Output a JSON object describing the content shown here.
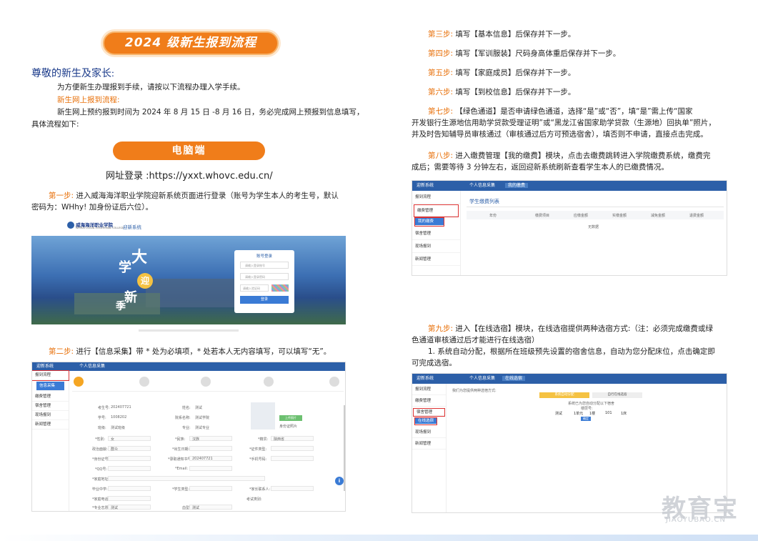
{
  "title": "2024 级新生报到流程",
  "greeting": "尊敬的新生及家长:",
  "intro": "为方便新生办理报到手续，请按以下流程办理入学手续。",
  "online_heading": "新生网上报到流程:",
  "online_text_1": "新生网上预约报到时间为 2024 年 8 月 15 日 -8 月 16 日，务必完成网上预报到信息填写，",
  "online_text_2": "具体流程如下:",
  "pc_label": "电脑端",
  "url_line": "网址登录 :https://yxxt.whovc.edu.cn/",
  "steps": {
    "s1_label": "第一步:",
    "s1_text_1": "进入威海海洋职业学院迎新系统页面进行登录（账号为学生本人的考生号，默认",
    "s1_text_2": "密码为：WHhy! 加身份证后六位）。",
    "s2_label": "第二步:",
    "s2_text": "进行【信息采集】带 * 处为必填项，* 处若本人无内容填写，可以填写“无”。",
    "s3_label": "第三步:",
    "s3_text": "填写【基本信息】后保存并下一步。",
    "s4_label": "第四步:",
    "s4_text": "填写【军训服装】尺码身高体重后保存并下一步。",
    "s5_label": "第五步:",
    "s5_text": "填写【家庭成员】后保存并下一步。",
    "s6_label": "第六步:",
    "s6_text": "填写【到校信息】后保存并下一步。",
    "s7_label": "第七步:",
    "s7_text_1": "【绿色通道】是否申请绿色通道，选择“是”或“否”，填“是”需上传“国家",
    "s7_text_2": "开发银行生源地信用助学贷款受理证明”或“黑龙江省国家助学贷款（生源地）回执单”照片，",
    "s7_text_3": "并及时告知辅导员审核通过（审核通过后方可预选宿舍），填否则不申请，直接点击完成。",
    "s8_label": "第八步:",
    "s8_text_1": "进入缴费管理【我的缴费】模块，点击去缴费跳转进入学院缴费系统，缴费完",
    "s8_text_2": "成后；需要等待 3 分钟左右，返回迎新系统刷新查看学生本人的已缴费情况。",
    "s9_label": "第九步:",
    "s9_text_1": "进入【在线选宿】模块，在线选宿提供两种选宿方式:（注：必须完成缴费或绿",
    "s9_text_2": "色通道审核通过后才能进行在线选宿）",
    "s9_text_3": "1. 系统自动分配，根据所在班级预先设置的宿舍信息，自动为您分配床位，点击确定即",
    "s9_text_4": "可完成选宿。"
  },
  "shot_login": {
    "school_name": "威海海洋职业学院",
    "school_en": "WEIHAI OCEAN VOCATIONAL COLLEGE",
    "system_name": "迎新系统",
    "login_title": "账号登录",
    "username_ph": "请输入登录账号",
    "password_ph": "请输入登录密码",
    "captcha_ph": "请输入验证码",
    "login_btn": "登录",
    "slogan_1": "大",
    "slogan_2": "学",
    "slogan_3": "迎",
    "slogan_4": "新",
    "slogan_5": "季"
  },
  "shot_info": {
    "system": "迎新系统",
    "tab": "个人信息采集",
    "menu": [
      "报到流程",
      "信息采集",
      "缴费管理",
      "宿舍管理",
      "现场报到",
      "新闻管理"
    ],
    "labels": [
      "考生号:",
      "姓名:",
      "学号:",
      "院系名称:",
      "班级:",
      "专业:",
      "*性别:",
      "*民族:",
      "*籍贯:",
      "政治面貌:",
      "*出生日期:",
      "*证件类型:",
      "*身份证号:",
      "*录取通知书号:",
      "*手机号码:",
      "*QQ号:",
      "*Email:",
      "*家庭地址:",
      "毕业中学:",
      "*学生类型:",
      "*家长联系人:",
      "*家庭电话:",
      "考试类别:",
      "*专业志愿:",
      "血型:",
      "身份证照片"
    ],
    "values": [
      "202407721",
      "测试",
      "1008202",
      "测试学院",
      "测试班级",
      "测试专业",
      "女",
      "汉族",
      "陕西省",
      "群众",
      "202407721",
      "测试",
      "测试"
    ],
    "upload_btn": "上传照片"
  },
  "shot_fee": {
    "system": "迎新系统",
    "tab_1": "个人信息采集",
    "tab_2": "我的缴费",
    "menu": [
      "报到流程",
      "缴费管理",
      "我的缴费",
      "宿舍管理",
      "现场报到",
      "新闻管理"
    ],
    "table_title": "学生缴费列表",
    "columns": [
      "年份",
      "缴费项目",
      "应缴金额",
      "实缴金额",
      "减免金额",
      "退费金额"
    ],
    "empty": "无数据"
  },
  "shot_dorm": {
    "system": "迎新系统",
    "tab_1": "个人信息采集",
    "tab_2": "在线选宿",
    "menu": [
      "报到流程",
      "缴费管理",
      "宿舍管理",
      "在线选宿",
      "现场报到",
      "新闻管理"
    ],
    "hint": "我们为您提供两种选宿方式:",
    "mode_1": "系统自动分配",
    "mode_2": "自行在线选宿",
    "assigned": "系统已为您自动分配以下宿舍",
    "dorm_no": "楼层号:",
    "row": [
      "测试",
      "1单元",
      "1楼",
      "101",
      "1床"
    ],
    "confirm": "确定"
  },
  "watermark": "教育宝",
  "watermark_url": "JIAOYUBAO.CN",
  "colors": {
    "accent": "#f07d1a",
    "brand": "#2c5fa8",
    "step": "#e8700a"
  }
}
